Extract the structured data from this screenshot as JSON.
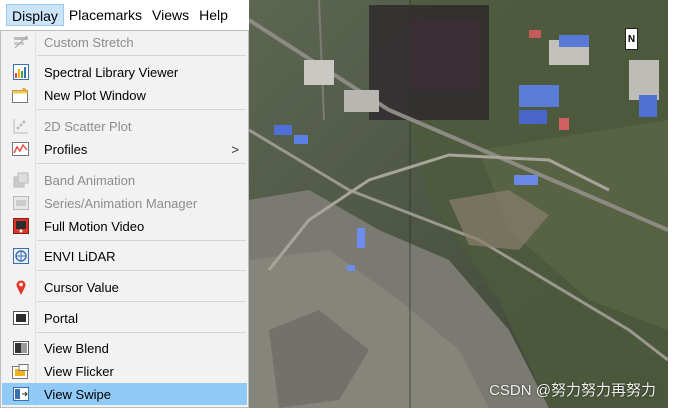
{
  "menubar": {
    "items": [
      {
        "label": "Display",
        "active": true
      },
      {
        "label": "Placemarks"
      },
      {
        "label": "Views"
      },
      {
        "label": "Help"
      }
    ]
  },
  "menu": {
    "items": [
      {
        "label": "Custom Stretch",
        "icon": "custom-stretch-icon",
        "disabled": true
      },
      {
        "label": "Spectral Library Viewer",
        "icon": "spectral-library-icon"
      },
      {
        "label": "New Plot Window",
        "icon": "plot-window-icon"
      },
      {
        "label": "2D Scatter Plot",
        "icon": "scatter-plot-icon",
        "disabled": true
      },
      {
        "label": "Profiles",
        "icon": "profiles-icon",
        "submenu": true
      },
      {
        "label": "Band Animation",
        "icon": "band-animation-icon",
        "disabled": true
      },
      {
        "label": "Series/Animation Manager",
        "icon": "series-manager-icon",
        "disabled": true
      },
      {
        "label": "Full Motion Video",
        "icon": "motion-video-icon"
      },
      {
        "label": "ENVI LiDAR",
        "icon": "lidar-icon"
      },
      {
        "label": "Cursor Value",
        "icon": "map-pin-icon"
      },
      {
        "label": "Portal",
        "icon": "portal-icon"
      },
      {
        "label": "View Blend",
        "icon": "view-blend-icon"
      },
      {
        "label": "View Flicker",
        "icon": "view-flicker-icon"
      },
      {
        "label": "View Swipe",
        "icon": "view-swipe-icon",
        "selected": true
      }
    ],
    "submenu_arrow": ">"
  },
  "image": {
    "north_label": "N",
    "watermark": "CSDN @努力努力再努力"
  },
  "colors": {
    "menu_bg": "#f2f2f2",
    "selected_bg": "#91c9f7",
    "disabled_text": "#8c8c8c"
  }
}
